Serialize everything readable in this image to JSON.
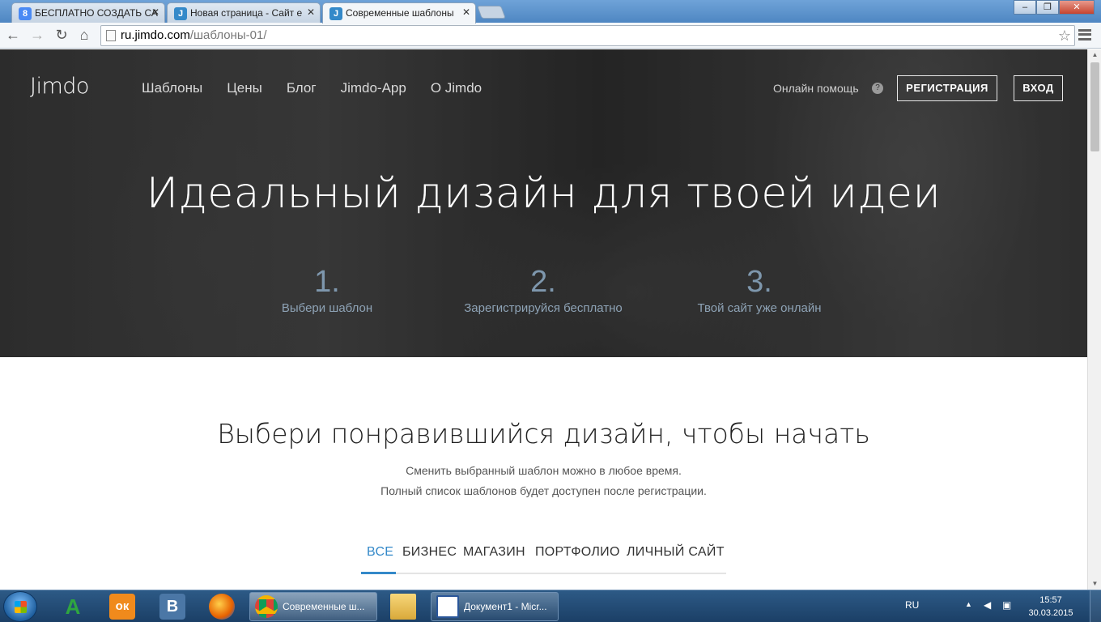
{
  "browser": {
    "tabs": [
      {
        "title": "БЕСПЛАТНО СОЗДАТЬ СА",
        "favicon": "8",
        "favicon_color": "#4a8af4",
        "active": false
      },
      {
        "title": "Новая страница - Сайт е",
        "favicon": "J",
        "favicon_color": "#3489c9",
        "active": false
      },
      {
        "title": "Современные шаблоны",
        "favicon": "J",
        "favicon_color": "#3489c9",
        "active": true
      }
    ],
    "close_glyph": "✕",
    "url_host": "ru.jimdo.com",
    "url_path": "/шаблоны-01/",
    "back": "←",
    "forward": "→",
    "reload": "↻",
    "home": "⌂",
    "star": "☆",
    "win_minimize": "–",
    "win_maximize": "❐",
    "win_close": "✕"
  },
  "header": {
    "logo": "Jimdo",
    "nav": [
      "Шаблоны",
      "Цены",
      "Блог",
      "Jimdo-App",
      "О Jimdo"
    ],
    "help_text": "Онлайн помощь",
    "help_icon": "?",
    "register": "РЕГИСТРАЦИЯ",
    "login": "ВХОД"
  },
  "hero": {
    "title": "Идеальный дизайн для твоей идеи",
    "steps": [
      {
        "num": "1.",
        "label": "Выбери шаблон"
      },
      {
        "num": "2.",
        "label": "Зарегистрируйся бесплатно"
      },
      {
        "num": "3.",
        "label": "Твой сайт уже онлайн"
      }
    ]
  },
  "section": {
    "title": "Выбери понравившийся дизайн, чтобы начать",
    "subtitle_1": "Сменить выбранный шаблон можно в любое время.",
    "subtitle_2": "Полный список шаблонов будет доступен после регистрации.",
    "filters": [
      "ВСЕ",
      "БИЗНЕС",
      "МАГАЗИН",
      "ПОРТФОЛИО",
      "ЛИЧНЫЙ САЙТ"
    ],
    "active_filter": "ВСЕ"
  },
  "taskbar": {
    "pinned": [
      {
        "name": "A",
        "color": "#2fa640"
      },
      {
        "name": "ок",
        "color": "#f08a1c"
      },
      {
        "name": "В",
        "color": "#4b77a6"
      }
    ],
    "tasks": [
      {
        "title": "Современные ш...",
        "active": true
      },
      {
        "title": "Документ1 - Micr...",
        "active": false
      }
    ],
    "lang": "RU",
    "time": "15:57",
    "date": "30.03.2015"
  },
  "colors": {
    "accent": "#3489c9",
    "step_number": "#7e97ad"
  }
}
